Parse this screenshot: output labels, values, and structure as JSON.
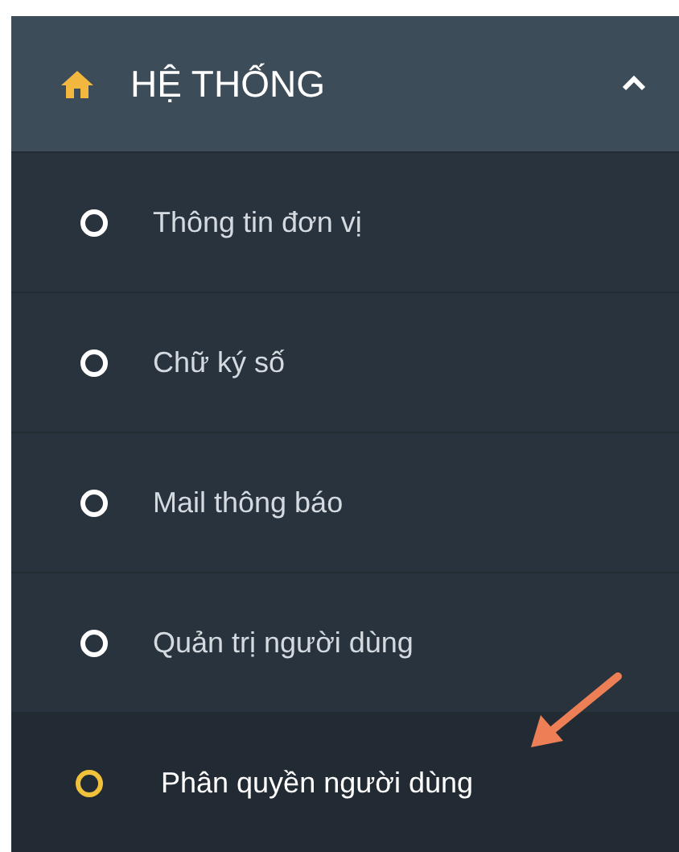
{
  "menu": {
    "title": "HỆ THỐNG",
    "expanded": true,
    "items": [
      {
        "label": "Thông tin đơn vị",
        "selected": false
      },
      {
        "label": "Chữ ký số",
        "selected": false
      },
      {
        "label": "Mail thông báo",
        "selected": false
      },
      {
        "label": "Quản trị người dùng",
        "selected": false
      },
      {
        "label": "Phân quyền người dùng",
        "selected": true
      }
    ]
  }
}
